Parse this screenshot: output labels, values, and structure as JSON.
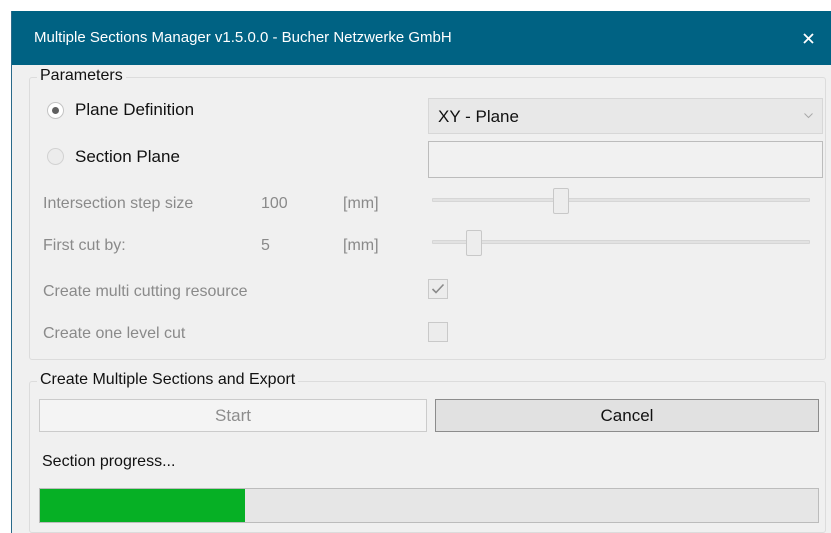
{
  "window": {
    "title": "Multiple Sections Manager v1.5.0.0 - Bucher Netzwerke GmbH"
  },
  "parameters": {
    "legend": "Parameters",
    "plane_definition": {
      "label": "Plane Definition",
      "selected": true
    },
    "plane_select": {
      "value": "XY - Plane"
    },
    "section_plane": {
      "label": "Section Plane",
      "selected": false,
      "value": ""
    },
    "step_size": {
      "label": "Intersection step size",
      "value": "100",
      "unit": "[mm]",
      "slider_fraction": 0.34
    },
    "first_cut": {
      "label": "First cut by:",
      "value": "5",
      "unit": "[mm]",
      "slider_fraction": 0.11
    },
    "multi_cutting": {
      "label": "Create multi cutting resource",
      "checked": true
    },
    "one_level": {
      "label": "Create one level cut",
      "checked": false
    }
  },
  "export": {
    "legend": "Create Multiple Sections and Export",
    "start_label": "Start",
    "cancel_label": "Cancel",
    "progress_label": "Section progress...",
    "progress_fraction": 0.264
  },
  "colors": {
    "titlebar": "#006283",
    "progress_fill": "#06b025"
  }
}
